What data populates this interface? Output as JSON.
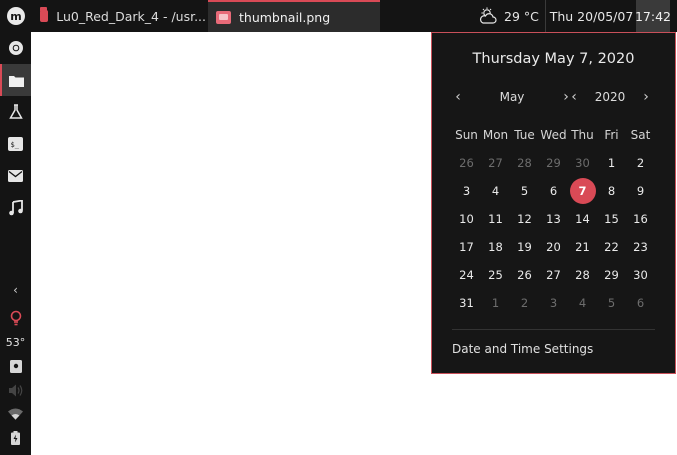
{
  "taskbar": {
    "tasks": [
      {
        "label": "Lu0_Red_Dark_4 - /usr..."
      },
      {
        "label": "thumbnail.png"
      }
    ],
    "weather": {
      "temperature": "29 °C",
      "icon": "partly-cloudy-icon"
    },
    "date": "Thu 20/05/07",
    "time": "17:42"
  },
  "sidebar": {
    "items": [
      {
        "name": "chrome-icon"
      },
      {
        "name": "files-icon"
      },
      {
        "name": "flask-icon"
      },
      {
        "name": "terminal-icon"
      },
      {
        "name": "mail-icon"
      },
      {
        "name": "music-icon"
      }
    ],
    "temperature": "53°"
  },
  "calendar": {
    "header": "Thursday May 7, 2020",
    "month": "May",
    "year": "2020",
    "weekdays": [
      "Sun",
      "Mon",
      "Tue",
      "Wed",
      "Thu",
      "Fri",
      "Sat"
    ],
    "weeks": [
      [
        {
          "d": "26",
          "dim": true
        },
        {
          "d": "27",
          "dim": true
        },
        {
          "d": "28",
          "dim": true
        },
        {
          "d": "29",
          "dim": true
        },
        {
          "d": "30",
          "dim": true
        },
        {
          "d": "1"
        },
        {
          "d": "2"
        }
      ],
      [
        {
          "d": "3"
        },
        {
          "d": "4"
        },
        {
          "d": "5"
        },
        {
          "d": "6"
        },
        {
          "d": "7",
          "today": true
        },
        {
          "d": "8"
        },
        {
          "d": "9"
        }
      ],
      [
        {
          "d": "10"
        },
        {
          "d": "11"
        },
        {
          "d": "12"
        },
        {
          "d": "13"
        },
        {
          "d": "14"
        },
        {
          "d": "15"
        },
        {
          "d": "16"
        }
      ],
      [
        {
          "d": "17"
        },
        {
          "d": "18"
        },
        {
          "d": "19"
        },
        {
          "d": "20"
        },
        {
          "d": "21"
        },
        {
          "d": "22"
        },
        {
          "d": "23"
        }
      ],
      [
        {
          "d": "24"
        },
        {
          "d": "25"
        },
        {
          "d": "26"
        },
        {
          "d": "27"
        },
        {
          "d": "28"
        },
        {
          "d": "29"
        },
        {
          "d": "30"
        }
      ],
      [
        {
          "d": "31"
        },
        {
          "d": "1",
          "dim": true
        },
        {
          "d": "2",
          "dim": true
        },
        {
          "d": "3",
          "dim": true
        },
        {
          "d": "4",
          "dim": true
        },
        {
          "d": "5",
          "dim": true
        },
        {
          "d": "6",
          "dim": true
        }
      ]
    ],
    "settings_label": "Date and Time Settings"
  },
  "colors": {
    "accent": "#d94a56",
    "panel": "#141414"
  }
}
